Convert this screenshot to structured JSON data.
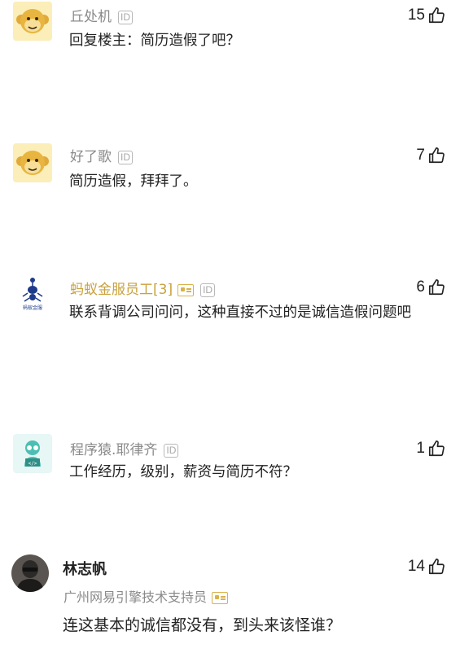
{
  "comments": [
    {
      "username": "丘处机",
      "id_badge": "ID",
      "likes": "15",
      "text": "回复楼主：简历造假了吧？",
      "avatar": "monkey-avatar"
    },
    {
      "username": "好了歌",
      "id_badge": "ID",
      "likes": "7",
      "text": "简历造假，拜拜了。",
      "avatar": "monkey-avatar"
    },
    {
      "username": "蚂蚁金服员工[3]",
      "id_badge": "ID",
      "likes": "6",
      "text": "联系背调公司问问，这种直接不过的是诚信造假问题吧",
      "avatar": "ant-financial-logo",
      "avatar_caption": "蚂蚁金服"
    },
    {
      "username": "程序猿.耶律齐",
      "id_badge": "ID",
      "likes": "1",
      "text": "工作经历，级别，薪资与简历不符？",
      "avatar": "coder-avatar"
    },
    {
      "username": "林志帆",
      "subtitle": "广州网易引擎技术支持员",
      "likes": "14",
      "text": "连这基本的诚信都没有，到头来该怪谁？",
      "avatar": "person-photo-avatar"
    }
  ],
  "colors": {
    "verified_gold": "#caa23d",
    "muted_text": "#8a8a8a",
    "monkey_yellow": "#f2c84b"
  }
}
